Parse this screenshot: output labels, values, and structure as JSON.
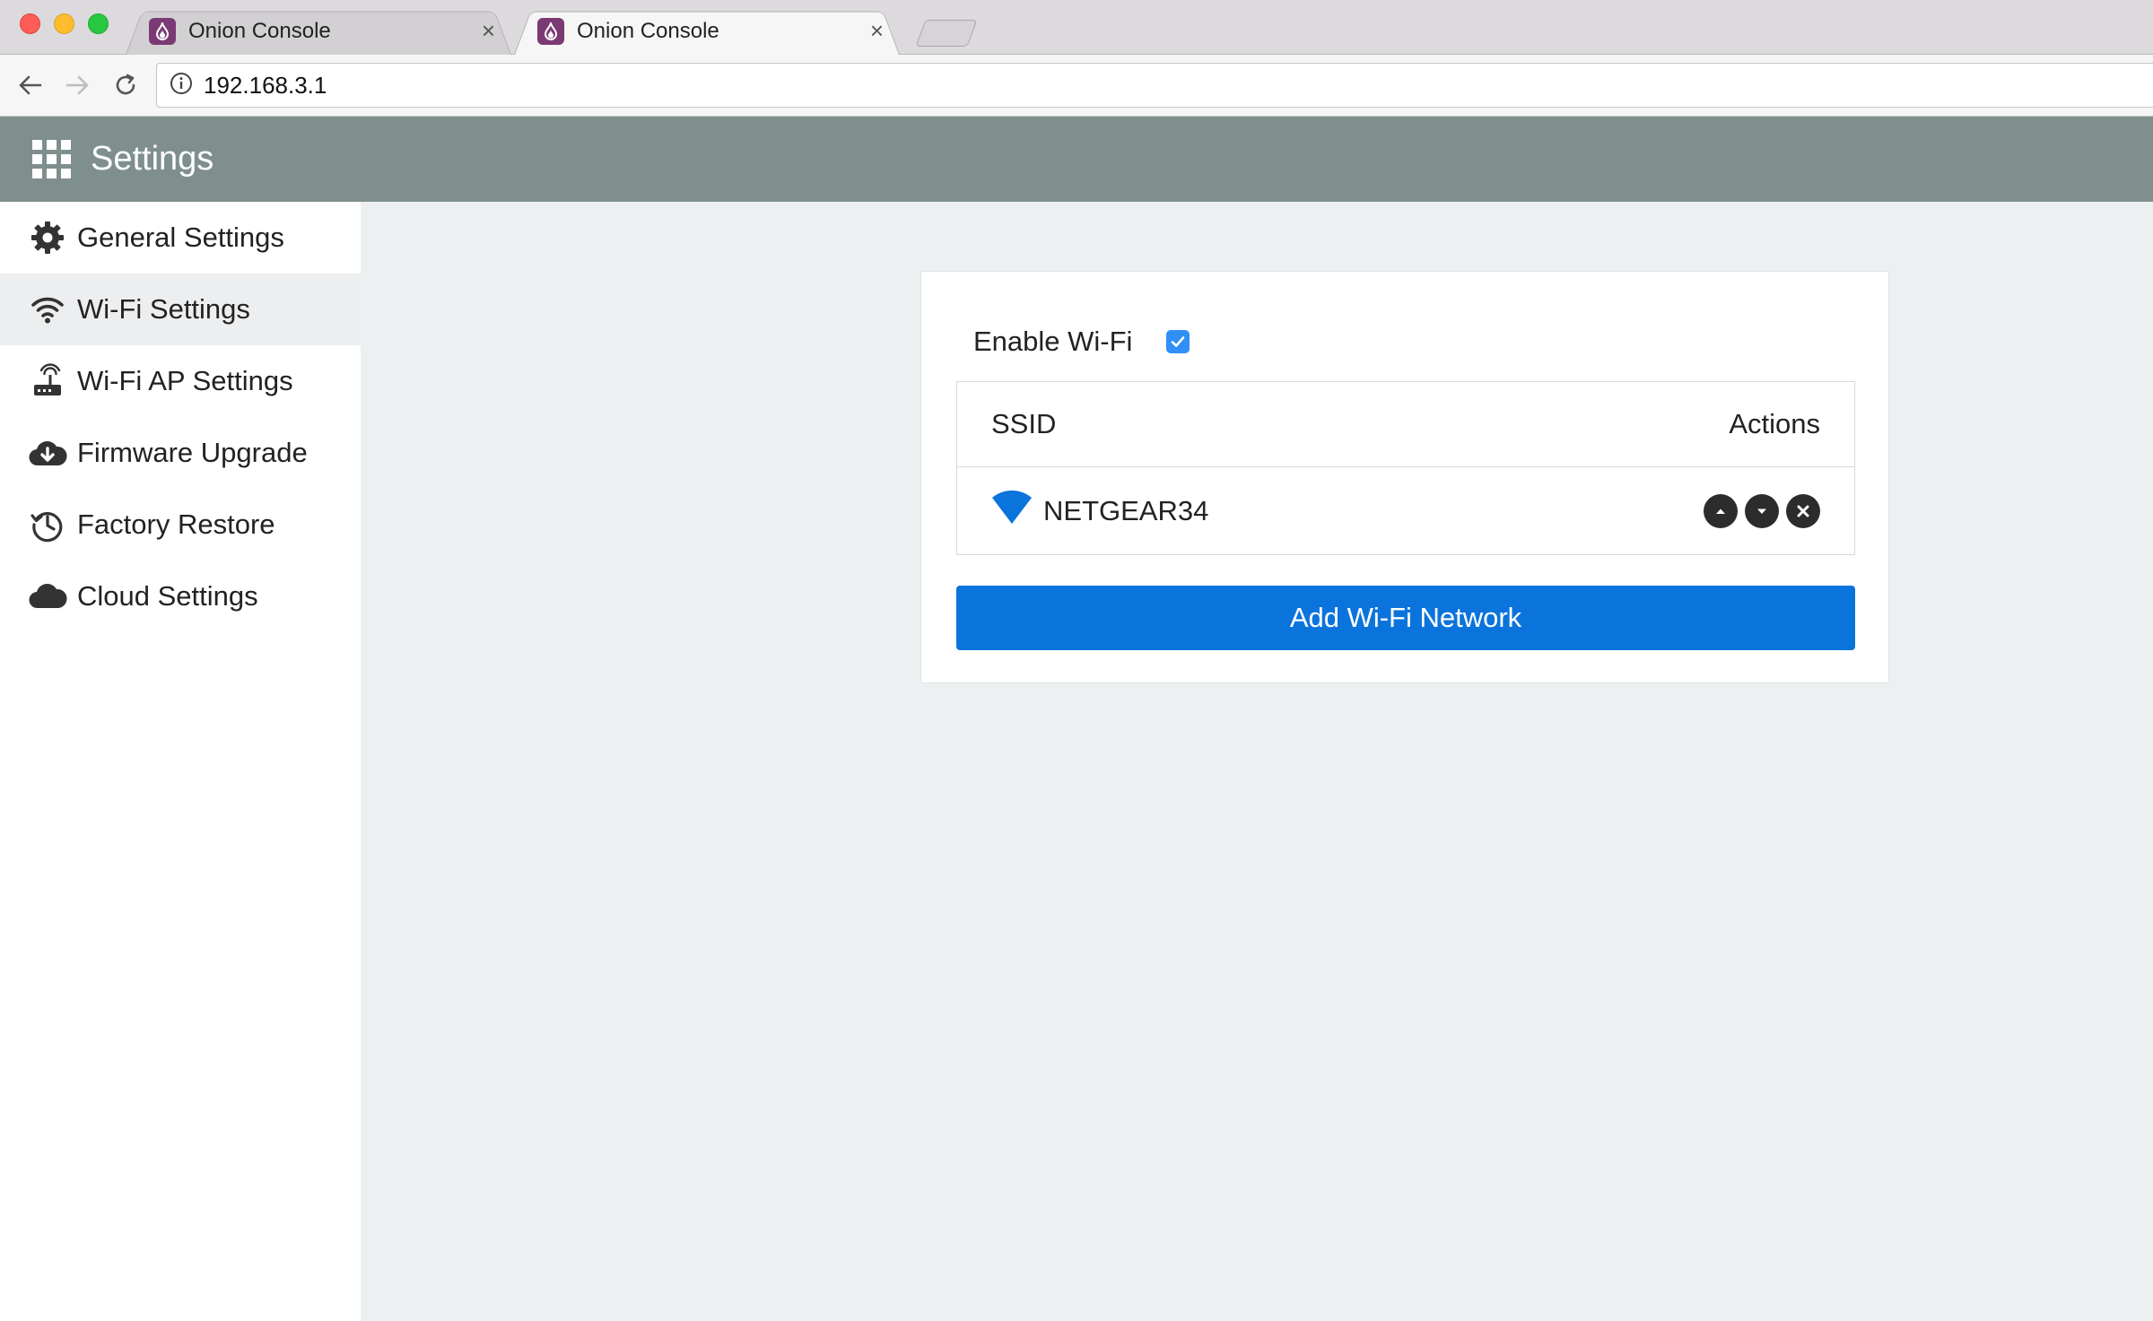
{
  "browser": {
    "tabs": [
      {
        "title": "Onion Console",
        "active": false
      },
      {
        "title": "Onion Console",
        "active": true
      }
    ],
    "close_glyph": "×",
    "url": "192.168.3.1"
  },
  "app": {
    "title": "Settings"
  },
  "sidebar": {
    "items": [
      {
        "label": "General Settings",
        "icon": "gear-icon",
        "active": false
      },
      {
        "label": "Wi-Fi Settings",
        "icon": "wifi-icon",
        "active": true
      },
      {
        "label": "Wi-Fi AP Settings",
        "icon": "router-icon",
        "active": false
      },
      {
        "label": "Firmware Upgrade",
        "icon": "cloud-download-icon",
        "active": false
      },
      {
        "label": "Factory Restore",
        "icon": "history-icon",
        "active": false
      },
      {
        "label": "Cloud Settings",
        "icon": "cloud-icon",
        "active": false
      }
    ]
  },
  "wifi": {
    "enable_label": "Enable Wi-Fi",
    "enabled": true,
    "table": {
      "headers": {
        "ssid": "SSID",
        "actions": "Actions"
      },
      "rows": [
        {
          "ssid": "NETGEAR34"
        }
      ]
    },
    "add_button_label": "Add Wi-Fi Network"
  },
  "colors": {
    "header_bg": "#7f8f8e",
    "accent_blue": "#0b74dc",
    "checkbox_blue": "#2f8ff5",
    "sidebar_active_bg": "#edeef0",
    "page_bg": "#edf0f1"
  }
}
